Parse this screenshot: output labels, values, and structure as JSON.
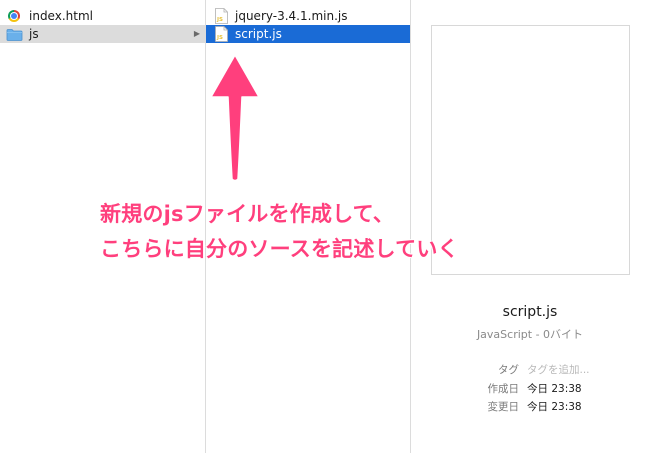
{
  "columns": {
    "left": {
      "items": [
        {
          "label": "index.html",
          "icon": "chrome-icon"
        },
        {
          "label": "js",
          "icon": "folder-icon"
        }
      ]
    },
    "middle": {
      "items": [
        {
          "label": "jquery-3.4.1.min.js",
          "icon": "js-file-icon"
        },
        {
          "label": "script.js",
          "icon": "js-file-icon"
        }
      ]
    }
  },
  "preview": {
    "file_name": "script.js",
    "kind": "JavaScript - 0バイト",
    "tags_label": "タグ",
    "tags_placeholder": "タグを追加...",
    "created_label": "作成日",
    "created_value": "今日 23:38",
    "modified_label": "変更日",
    "modified_value": "今日 23:38"
  },
  "annotation": {
    "line1": "新規のjsファイルを作成して、",
    "line2": "こちらに自分のソースを記述していく",
    "color": "#ff3f7d"
  },
  "colors": {
    "selection_blue": "#1a6bd6",
    "selection_gray": "#dcdcdc",
    "folder_blue": "#6ab0ea",
    "js_icon_yellow": "#e9c23a"
  }
}
